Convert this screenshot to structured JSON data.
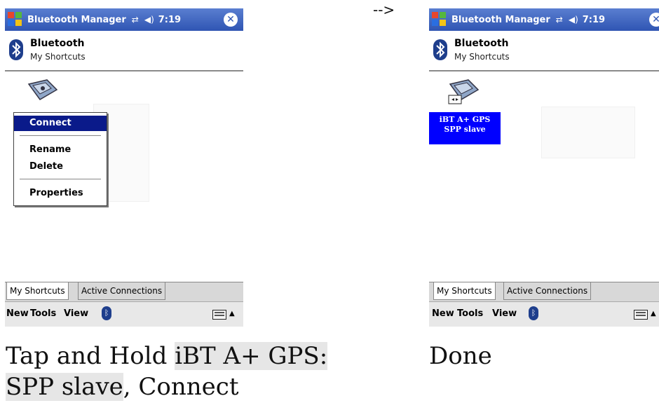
{
  "arrow": "-->",
  "left": {
    "title": "Bluetooth Manager",
    "clock": "7:19",
    "header_title": "Bluetooth",
    "header_sub": "My Shortcuts",
    "context_menu": [
      "Connect",
      "Rename",
      "Delete",
      "Properties"
    ],
    "tabs": [
      "My Shortcuts",
      "Active Connections"
    ],
    "menubar": [
      "New",
      "Tools",
      "View"
    ]
  },
  "right": {
    "title": "Bluetooth Manager",
    "clock": "7:19",
    "header_title": "Bluetooth",
    "header_sub": "My Shortcuts",
    "selected_label_line1": "iBT A+ GPS",
    "selected_label_line2": "SPP slave",
    "tabs": [
      "My Shortcuts",
      "Active Connections"
    ],
    "menubar": [
      "New",
      "Tools",
      "View"
    ]
  },
  "captions": {
    "left_part1": "Tap and Hold ",
    "left_highlight1": "iBT A+ GPS:",
    "left_highlight2": "SPP slave",
    "left_part2": ", Connect",
    "right": "Done"
  },
  "colors": {
    "titlebar": "#2f55b3",
    "selection": "#0000ff",
    "menu_selection": "#0a1a8a"
  },
  "icons": [
    "windows-flag-icon",
    "connectivity-icon",
    "speaker-icon",
    "close-icon",
    "bluetooth-icon",
    "gps-device-icon",
    "keyboard-icon",
    "up-arrow-icon"
  ]
}
